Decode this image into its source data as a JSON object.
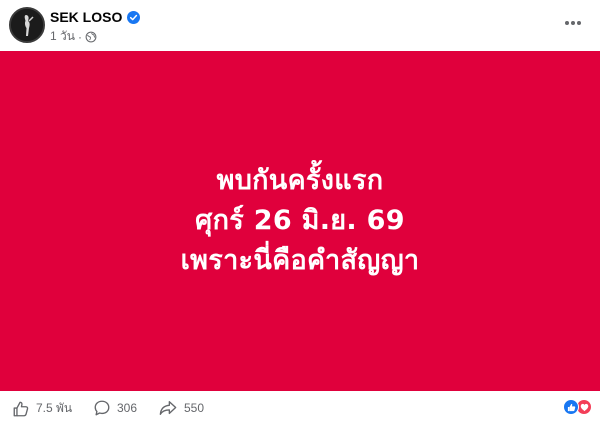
{
  "post": {
    "author": "SEK LOSO",
    "timestamp": "1 วัน",
    "separator": "·",
    "verified": true,
    "privacy_icon": "globe-icon",
    "more_icon": "more-horizontal-icon"
  },
  "banner": {
    "background": "#e0003c",
    "text_color": "#ffffff",
    "lines": [
      "พบกันครั้งแรก",
      "ศุกร์ 26 มิ.ย. 69",
      "เพราะนี่คือคำสัญญา"
    ]
  },
  "footer": {
    "likes": "7.5 พัน",
    "comments": "306",
    "shares": "550",
    "reactions": [
      "like",
      "love"
    ]
  },
  "colors": {
    "brand_blue": "#1877f2",
    "love_red": "#f33e58",
    "secondary_text": "#65676b"
  }
}
